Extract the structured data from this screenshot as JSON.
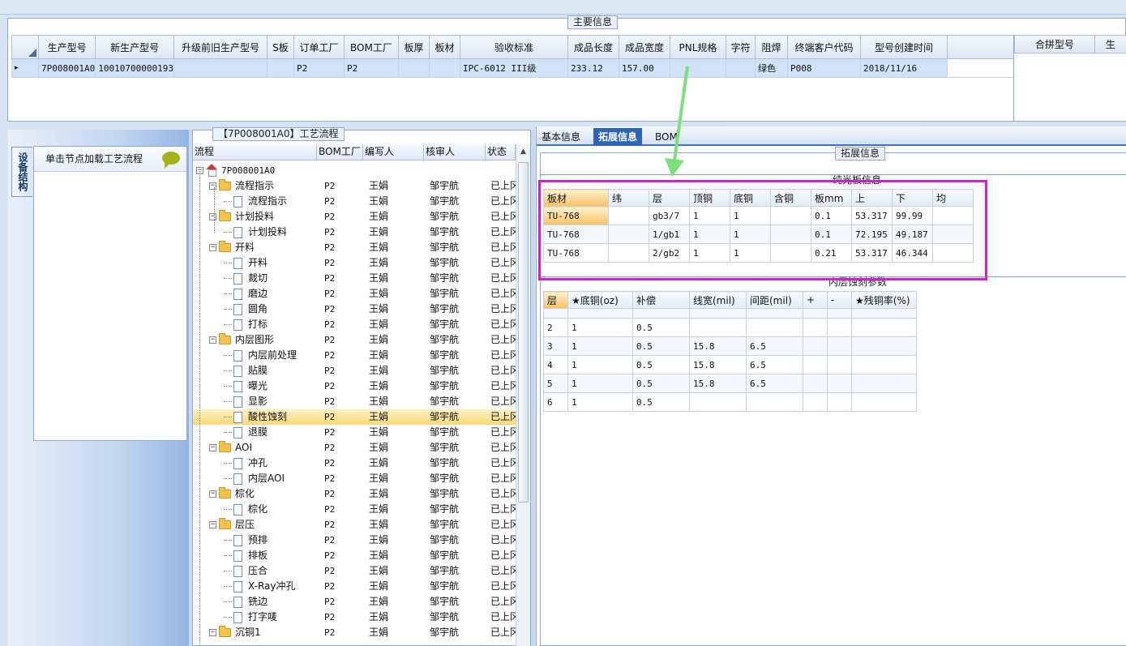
{
  "main_info": {
    "title": "主要信息",
    "columns": [
      "生产型号",
      "新生产型号",
      "升级前旧生产型号",
      "S板",
      "订单工厂",
      "BOM工厂",
      "板厚",
      "板材",
      "验收标准",
      "成品长度",
      "成品宽度",
      "PNL规格",
      "字符",
      "阻焊",
      "终端客户代码",
      "型号创建时间"
    ],
    "row": {
      "marker": "▸",
      "cells": [
        "7P008001A0",
        "10010700000193",
        "",
        "",
        "P2",
        "P2",
        "",
        "",
        "IPC-6012 III级",
        "233.12",
        "157.00",
        "",
        "",
        "绿色",
        "P008",
        "2018/11/16"
      ]
    },
    "merge_columns": [
      "合拼型号",
      "生"
    ]
  },
  "device": {
    "tab_label": "设备结构",
    "hint": "单击节点加载工艺流程"
  },
  "flow": {
    "title": "【7P008001A0】工艺流程",
    "columns": [
      "流程",
      "BOM工厂",
      "编写人",
      "核审人",
      "状态"
    ],
    "rows": [
      {
        "level": 0,
        "kind": "root",
        "toggle": "−",
        "name": "7P008001A0",
        "bom": "",
        "writer": "",
        "checker": "",
        "status": ""
      },
      {
        "level": 1,
        "kind": "folder",
        "toggle": "−",
        "name": "流程指示",
        "bom": "P2",
        "writer": "王娟",
        "checker": "邹宇航",
        "status": "已上冈"
      },
      {
        "level": 2,
        "kind": "doc",
        "name": "流程指示",
        "bom": "P2",
        "writer": "王娟",
        "checker": "邹宇航",
        "status": "已上冈"
      },
      {
        "level": 1,
        "kind": "folder",
        "toggle": "−",
        "name": "计划投料",
        "bom": "P2",
        "writer": "王娟",
        "checker": "邹宇航",
        "status": "已上冈"
      },
      {
        "level": 2,
        "kind": "doc",
        "name": "计划投料",
        "bom": "P2",
        "writer": "王娟",
        "checker": "邹宇航",
        "status": "已上冈"
      },
      {
        "level": 1,
        "kind": "folder",
        "toggle": "−",
        "name": "开料",
        "bom": "P2",
        "writer": "王娟",
        "checker": "邹宇航",
        "status": "已上冈"
      },
      {
        "level": 2,
        "kind": "doc",
        "name": "开料",
        "bom": "P2",
        "writer": "王娟",
        "checker": "邹宇航",
        "status": "已上冈"
      },
      {
        "level": 2,
        "kind": "doc",
        "name": "裁切",
        "bom": "P2",
        "writer": "王娟",
        "checker": "邹宇航",
        "status": "已上冈"
      },
      {
        "level": 2,
        "kind": "doc",
        "name": "磨边",
        "bom": "P2",
        "writer": "王娟",
        "checker": "邹宇航",
        "status": "已上冈"
      },
      {
        "level": 2,
        "kind": "doc",
        "name": "圆角",
        "bom": "P2",
        "writer": "王娟",
        "checker": "邹宇航",
        "status": "已上冈"
      },
      {
        "level": 2,
        "kind": "doc",
        "name": "打标",
        "bom": "P2",
        "writer": "王娟",
        "checker": "邹宇航",
        "status": "已上冈"
      },
      {
        "level": 1,
        "kind": "folder",
        "toggle": "−",
        "name": "内层图形",
        "bom": "P2",
        "writer": "王娟",
        "checker": "邹宇航",
        "status": "已上冈"
      },
      {
        "level": 2,
        "kind": "doc",
        "name": "内层前处理",
        "bom": "P2",
        "writer": "王娟",
        "checker": "邹宇航",
        "status": "已上冈"
      },
      {
        "level": 2,
        "kind": "doc",
        "name": "贴膜",
        "bom": "P2",
        "writer": "王娟",
        "checker": "邹宇航",
        "status": "已上冈"
      },
      {
        "level": 2,
        "kind": "doc",
        "name": "曝光",
        "bom": "P2",
        "writer": "王娟",
        "checker": "邹宇航",
        "status": "已上冈"
      },
      {
        "level": 2,
        "kind": "doc",
        "name": "显影",
        "bom": "P2",
        "writer": "王娟",
        "checker": "邹宇航",
        "status": "已上冈"
      },
      {
        "level": 2,
        "kind": "doc",
        "name": "酸性蚀刻",
        "bom": "P2",
        "writer": "王娟",
        "checker": "邹宇航",
        "status": "已上冈",
        "selected": true
      },
      {
        "level": 2,
        "kind": "doc",
        "name": "退膜",
        "bom": "P2",
        "writer": "王娟",
        "checker": "邹宇航",
        "status": "已上冈"
      },
      {
        "level": 1,
        "kind": "folder",
        "toggle": "−",
        "name": "AOI",
        "bom": "P2",
        "writer": "王娟",
        "checker": "邹宇航",
        "status": "已上冈"
      },
      {
        "level": 2,
        "kind": "doc",
        "name": "冲孔",
        "bom": "P2",
        "writer": "王娟",
        "checker": "邹宇航",
        "status": "已上冈"
      },
      {
        "level": 2,
        "kind": "doc",
        "name": "内层AOI",
        "bom": "P2",
        "writer": "王娟",
        "checker": "邹宇航",
        "status": "已上冈"
      },
      {
        "level": 1,
        "kind": "folder",
        "toggle": "−",
        "name": "棕化",
        "bom": "P2",
        "writer": "王娟",
        "checker": "邹宇航",
        "status": "已上冈"
      },
      {
        "level": 2,
        "kind": "doc",
        "name": "棕化",
        "bom": "P2",
        "writer": "王娟",
        "checker": "邹宇航",
        "status": "已上冈"
      },
      {
        "level": 1,
        "kind": "folder",
        "toggle": "−",
        "name": "层压",
        "bom": "P2",
        "writer": "王娟",
        "checker": "邹宇航",
        "status": "已上冈"
      },
      {
        "level": 2,
        "kind": "doc",
        "name": "预排",
        "bom": "P2",
        "writer": "王娟",
        "checker": "邹宇航",
        "status": "已上冈"
      },
      {
        "level": 2,
        "kind": "doc",
        "name": "排板",
        "bom": "P2",
        "writer": "王娟",
        "checker": "邹宇航",
        "status": "已上冈"
      },
      {
        "level": 2,
        "kind": "doc",
        "name": "压合",
        "bom": "P2",
        "writer": "王娟",
        "checker": "邹宇航",
        "status": "已上冈"
      },
      {
        "level": 2,
        "kind": "doc",
        "name": "X-Ray冲孔",
        "bom": "P2",
        "writer": "王娟",
        "checker": "邹宇航",
        "status": "已上冈"
      },
      {
        "level": 2,
        "kind": "doc",
        "name": "铣边",
        "bom": "P2",
        "writer": "王娟",
        "checker": "邹宇航",
        "status": "已上冈"
      },
      {
        "level": 2,
        "kind": "doc",
        "name": "打字唛",
        "bom": "P2",
        "writer": "王娟",
        "checker": "邹宇航",
        "status": "已上冈"
      },
      {
        "level": 1,
        "kind": "folder",
        "toggle": "−",
        "name": "沉铜1",
        "bom": "P2",
        "writer": "王娟",
        "checker": "邹宇航",
        "status": "已上冈"
      }
    ]
  },
  "tabs": {
    "items": [
      "基本信息",
      "拓展信息",
      "BOM"
    ],
    "active": 1
  },
  "extended": {
    "title": "拓展信息",
    "core_title": "纯光板信息",
    "core_columns": [
      "板材",
      "纬",
      "层",
      "顶铜",
      "底铜",
      "含铜",
      "板mm",
      "上",
      "下",
      "均"
    ],
    "core_rows": [
      [
        "TU-768",
        "",
        "gb3/7",
        "1",
        "1",
        "",
        "0.1",
        "53.317",
        "99.99",
        ""
      ],
      [
        "TU-768",
        "",
        "1/gb1",
        "1",
        "1",
        "",
        "0.1",
        "72.195",
        "49.187",
        ""
      ],
      [
        "TU-768",
        "",
        "2/gb2",
        "1",
        "1",
        "",
        "0.21",
        "53.317",
        "46.344",
        ""
      ]
    ],
    "etch_title": "内层蚀刻参数",
    "etch_columns": [
      "层",
      "★底铜(oz)",
      "补偿",
      "线宽(mil)",
      "间距(mil)",
      "+",
      "-",
      "★残铜率(%)"
    ],
    "etch_rows": [
      [
        "",
        "",
        "",
        "",
        "",
        "",
        "",
        ""
      ],
      [
        "2",
        "1",
        "0.5",
        "",
        "",
        "",
        "",
        ""
      ],
      [
        "3",
        "1",
        "0.5",
        "15.8",
        "6.5",
        "",
        "",
        ""
      ],
      [
        "4",
        "1",
        "0.5",
        "15.8",
        "6.5",
        "",
        "",
        ""
      ],
      [
        "5",
        "1",
        "0.5",
        "15.8",
        "6.5",
        "",
        "",
        ""
      ],
      [
        "6",
        "1",
        "0.5",
        "",
        "",
        "",
        "",
        ""
      ]
    ]
  },
  "annotations": {
    "highlight_color": "#d21ed2",
    "arrow_color": "#7be07b"
  }
}
